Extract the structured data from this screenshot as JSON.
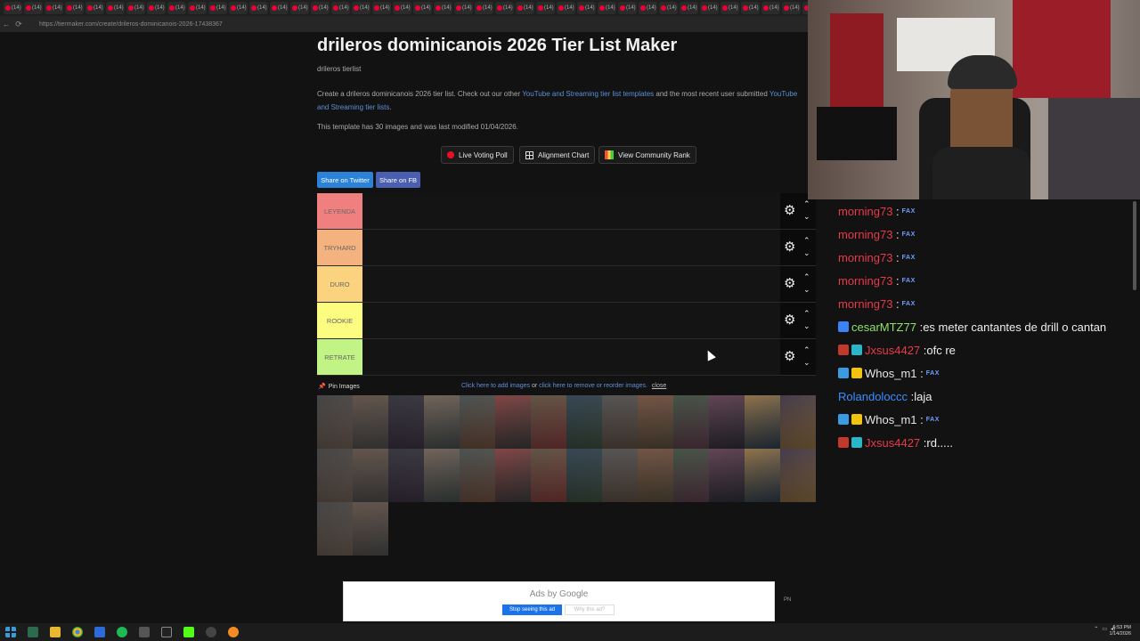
{
  "browser": {
    "tab_label": "(14)",
    "tab_count": 40,
    "url": "https://tiermaker.com/create/drileros-dominicanois-2026-17438367"
  },
  "page": {
    "title": "drileros dominicanois 2026 Tier List Maker",
    "subtitle": "drileros tierlist",
    "desc_prefix": "Create a drileros dominicanois 2026 tier list. Check out our other ",
    "desc_link1": "YouTube and Streaming tier list templates",
    "desc_mid": " and the most recent user submitted ",
    "desc_link2": "YouTube and Streaming tier lists",
    "desc_suffix": ".",
    "modified": "This template has 30 images and was last modified 01/04/2026."
  },
  "actions": {
    "live_voting": "Live Voting Poll",
    "alignment_chart": "Alignment Chart",
    "community_rank": "View Community Rank",
    "share_twitter": "Share on Twitter",
    "share_fb": "Share on FB"
  },
  "tiers": [
    {
      "label": "LEYENDA",
      "color": "#f08080"
    },
    {
      "label": "TRYHARD",
      "color": "#f4b27e"
    },
    {
      "label": "DURO",
      "color": "#fbd37e"
    },
    {
      "label": "ROOKIE",
      "color": "#fcfc80"
    },
    {
      "label": "RETRATE",
      "color": "#c2f385"
    }
  ],
  "images": {
    "pin_label": "Pin Images",
    "add_link": "Click here to add images",
    "or": " or ",
    "remove_link": "click here to remove or reorder images.",
    "close": "close",
    "count": 30
  },
  "ads": {
    "title": "Ads by Google",
    "stop": "Stop seeing this ad",
    "why": "Why this ad?",
    "side": "PN"
  },
  "chat": [
    {
      "user": "morning73",
      "text": "",
      "color": "#e83a4a",
      "badges": [],
      "fax": true
    },
    {
      "user": "morning73",
      "text": "",
      "color": "#e83a4a",
      "badges": [],
      "fax": true
    },
    {
      "user": "morning73",
      "text": "",
      "color": "#e83a4a",
      "badges": [],
      "fax": true
    },
    {
      "user": "morning73",
      "text": "",
      "color": "#e83a4a",
      "badges": [],
      "fax": true
    },
    {
      "user": "morning73",
      "text": "",
      "color": "#e83a4a",
      "badges": [],
      "fax": true
    },
    {
      "user": "cesarMTZ77",
      "text": " es meter cantantes de drill o cantan",
      "color": "#8fe36b",
      "badges": [
        "#3b82f6"
      ],
      "fax": false
    },
    {
      "user": "Jxsus4427",
      "text": " ofc re",
      "color": "#e83a4a",
      "badges": [
        "#c0392b",
        "#2bb5c9"
      ],
      "fax": false
    },
    {
      "user": "Whos_m1",
      "text": "",
      "color": "#e6e6e6",
      "badges": [
        "#3b9be0",
        "#f1c40f"
      ],
      "fax": true
    },
    {
      "user": "Rolandoloccc",
      "text": " laja",
      "color": "#3a8dff",
      "badges": [],
      "fax": false
    },
    {
      "user": "Whos_m1",
      "text": "",
      "color": "#e6e6e6",
      "badges": [
        "#3b9be0",
        "#f1c40f"
      ],
      "fax": true
    },
    {
      "user": "Jxsus4427",
      "text": " rd.....",
      "color": "#e83a4a",
      "badges": [
        "#c0392b",
        "#2bb5c9"
      ],
      "fax": false
    }
  ],
  "chat_fax": "FAX",
  "taskbar": {
    "time": "6:53 PM",
    "date": "1/14/2026"
  }
}
